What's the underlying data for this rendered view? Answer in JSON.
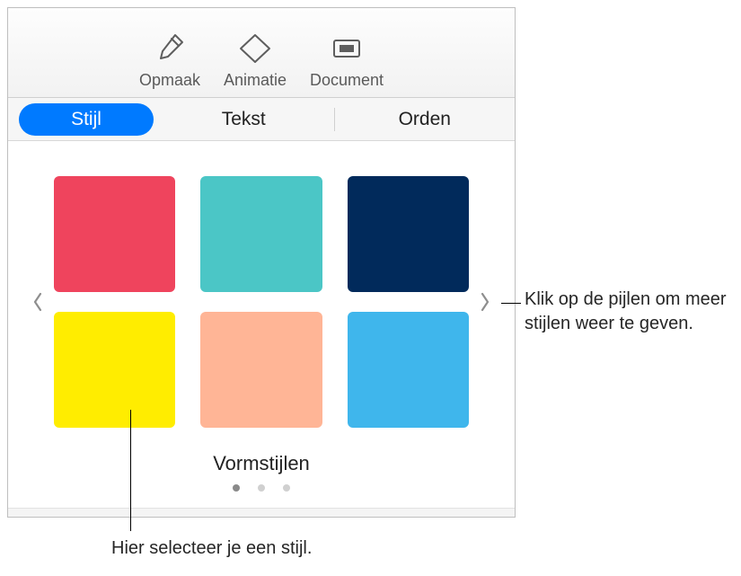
{
  "toolbar": {
    "items": [
      {
        "label": "Opmaak",
        "icon": "brush-icon"
      },
      {
        "label": "Animatie",
        "icon": "diamond-icon"
      },
      {
        "label": "Document",
        "icon": "slide-icon"
      }
    ]
  },
  "tabs": {
    "items": [
      {
        "label": "Stijl",
        "active": true
      },
      {
        "label": "Tekst",
        "active": false
      },
      {
        "label": "Orden",
        "active": false
      }
    ]
  },
  "styles": {
    "section_label": "Vormstijlen",
    "swatches": [
      {
        "color": "#ef445d"
      },
      {
        "color": "#4bc6c6"
      },
      {
        "color": "#012a5b"
      },
      {
        "color": "#ffed00"
      },
      {
        "color": "#ffb596"
      },
      {
        "color": "#3fb6ec"
      }
    ],
    "pager": {
      "count": 3,
      "active_index": 0
    }
  },
  "callouts": {
    "arrows": "Klik op de pijlen om meer stijlen weer te geven.",
    "select": "Hier selecteer je een stijl."
  }
}
